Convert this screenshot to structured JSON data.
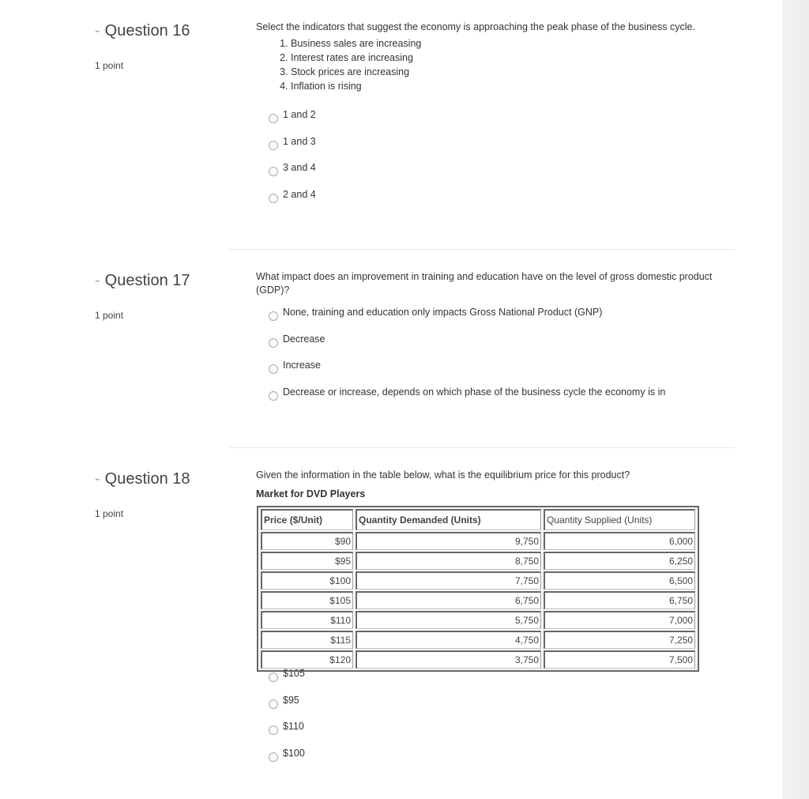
{
  "questions": [
    {
      "title": "Question 16",
      "points": "1 point",
      "text": "Select the indicators that suggest the economy is approaching the peak phase of the business cycle.",
      "list": [
        "Business sales are increasing",
        "Interest rates are increasing",
        "Stock prices are increasing",
        "Inflation is rising"
      ],
      "options": [
        "1 and 2",
        "1 and 3",
        "3 and 4",
        "2 and 4"
      ]
    },
    {
      "title": "Question 17",
      "points": "1 point",
      "text": "What impact does an improvement in training and education have on the level of gross domestic product (GDP)?",
      "options": [
        "None, training and education only impacts Gross National Product (GNP)",
        "Decrease",
        "Increase",
        "Decrease or increase, depends on which phase of the business cycle the economy is in"
      ]
    },
    {
      "title": "Question 18",
      "points": "1 point",
      "text": "Given the information in the table below, what is the equilibrium price for this product?",
      "table_title": "Market for DVD Players",
      "table": {
        "headers": [
          "Price ($/Unit)",
          "Quantity Demanded (Units)",
          "Quantity Supplied (Units)"
        ],
        "rows": [
          [
            "$90",
            "9,750",
            "6,000"
          ],
          [
            "$95",
            "8,750",
            "6,250"
          ],
          [
            "$100",
            "7,750",
            "6,500"
          ],
          [
            "$105",
            "6,750",
            "6,750"
          ],
          [
            "$110",
            "5,750",
            "7,000"
          ],
          [
            "$115",
            "4,750",
            "7,250"
          ],
          [
            "$120",
            "3,750",
            "7,500"
          ]
        ]
      },
      "options": [
        "$105",
        "$95",
        "$110",
        "$100"
      ]
    }
  ]
}
